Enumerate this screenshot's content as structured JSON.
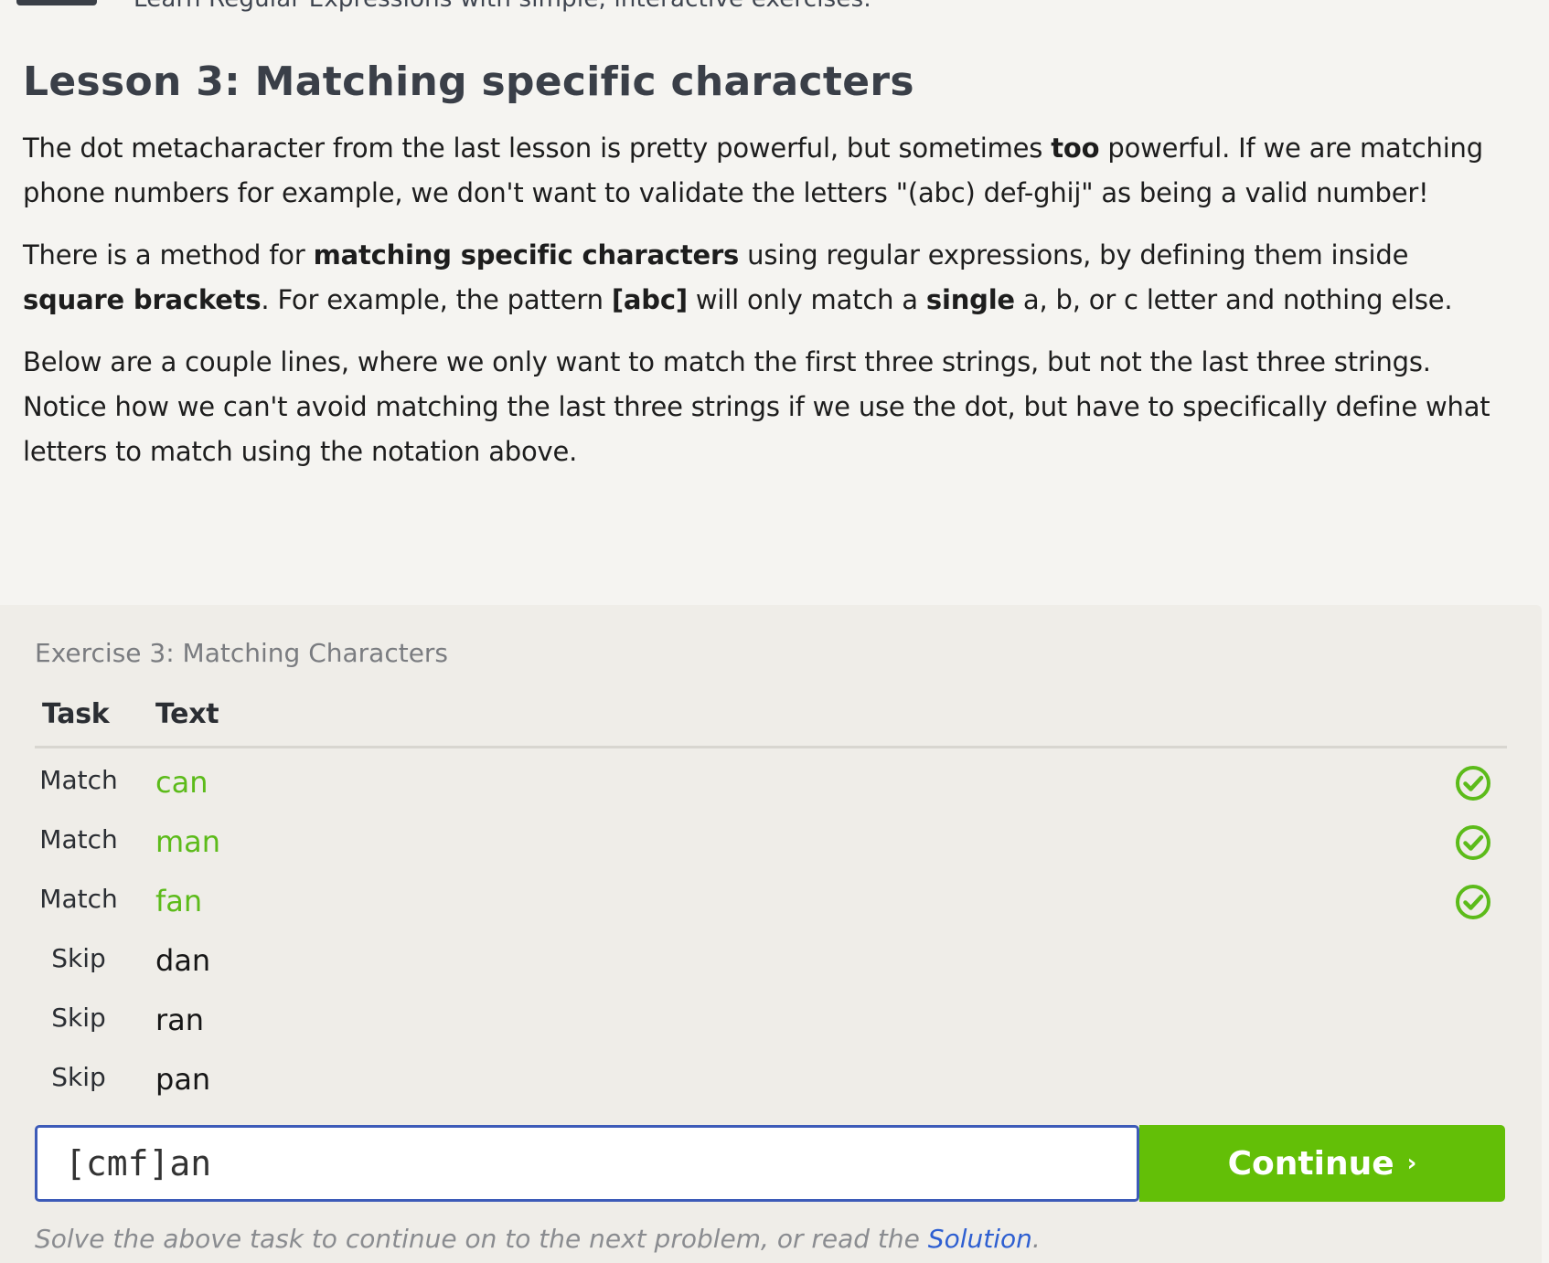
{
  "header": {
    "tagline": "Learn Regular Expressions with simple, interactive exercises."
  },
  "lesson": {
    "title": "Lesson 3: Matching specific characters",
    "p1": {
      "a": "The dot metacharacter from the last lesson is pretty powerful, but sometimes ",
      "b": "too",
      "c": " powerful. If we are matching phone numbers for example, we don't want to validate the letters \"(abc) def-ghij\" as being a valid number!"
    },
    "p2": {
      "a": "There is a method for ",
      "b": "matching specific characters",
      "c": " using regular expressions, by defining them inside ",
      "d": "square brackets",
      "e": ". For example, the pattern ",
      "f": "[abc]",
      "g": " will only match a ",
      "h": "single",
      "i": " a, b, or c letter and nothing else."
    },
    "p3": "Below are a couple lines, where we only want to match the first three strings, but not the last three strings. Notice how we can't avoid matching the last three strings if we use the dot, but have to specifically define what letters to match using the notation above."
  },
  "exercise": {
    "title": "Exercise 3: Matching Characters",
    "columns": {
      "task": "Task",
      "text": "Text"
    },
    "rows": [
      {
        "task": "Match",
        "text": "can",
        "status": "matched"
      },
      {
        "task": "Match",
        "text": "man",
        "status": "matched"
      },
      {
        "task": "Match",
        "text": "fan",
        "status": "matched"
      },
      {
        "task": "Skip",
        "text": "dan",
        "status": "none"
      },
      {
        "task": "Skip",
        "text": "ran",
        "status": "none"
      },
      {
        "task": "Skip",
        "text": "pan",
        "status": "none"
      }
    ],
    "input_value": "[cmf]an",
    "continue_label": "Continue",
    "continue_chevron": "›",
    "hint_text": "Solve the above task to continue on to the next problem, or read the ",
    "solution_link": "Solution",
    "hint_end": "."
  },
  "colors": {
    "match_green": "#5cbb1a",
    "continue_green": "#63bf07",
    "input_border": "#3d5bb8",
    "link_blue": "#2e5fd1"
  },
  "icons": {
    "check": "check-circle-icon"
  }
}
